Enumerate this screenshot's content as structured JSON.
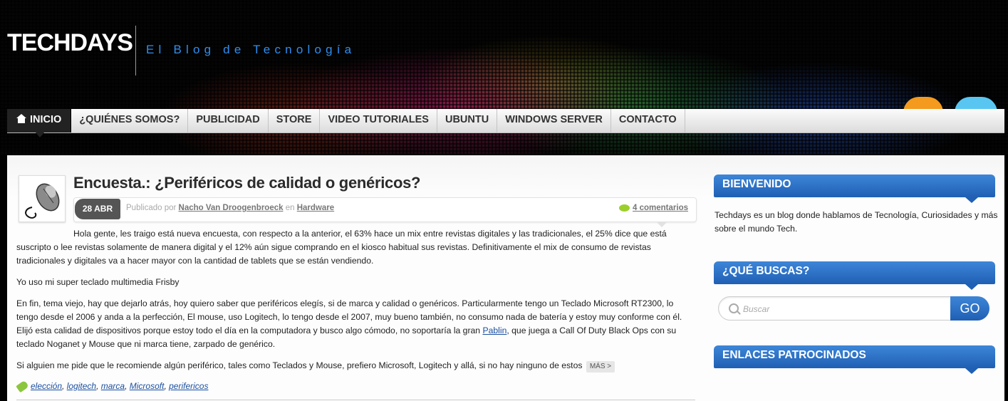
{
  "header": {
    "logo": "TECHDAYS",
    "tagline": "El Blog de Tecnología"
  },
  "social": {
    "rss_icon": "rss-icon",
    "twitter_icon": "twitter-icon"
  },
  "nav": {
    "items": [
      {
        "label": "INICIO",
        "icon": "home-icon",
        "active": true
      },
      {
        "label": "¿QUIÉNES SOMOS?"
      },
      {
        "label": "PUBLICIDAD"
      },
      {
        "label": "STORE"
      },
      {
        "label": "VIDEO TUTORIALES"
      },
      {
        "label": "UBUNTU"
      },
      {
        "label": "WINDOWS SERVER"
      },
      {
        "label": "CONTACTO"
      }
    ]
  },
  "post": {
    "title": "Encuesta.: ¿Periféricos de calidad o genéricos?",
    "date": "28 ABR",
    "published_by": "Publicado por",
    "author": "Nacho Van Droogenbroeck",
    "in_word": "en",
    "category": "Hardware",
    "comments": "4 comentarios",
    "paragraphs": {
      "p1": "Hola gente, les traigo está nueva encuesta, con respecto a la anterior, el 63% hace un mix entre revistas digitales y las tradicionales, el 25% dice que está suscripto o lee revistas solamente de manera digital y el 12% aún sigue comprando en el kiosco habitual sus revistas. Definitivamente el mix de consumo de revistas tradicionales y digitales va a hacer mayor con la cantidad de tablets que se están vendiendo.",
      "p2": "Yo uso mi super teclado multimedia Frisby",
      "p3_before": "En fin, tema viejo, hay que dejarlo atrás, hoy quiero saber que periféricos elegís, si de marca y calidad o genéricos. Particularmente tengo un Teclado Microsoft RT2300, lo tengo desde el 2006 y anda a la perfección, El mouse, uso Logitech, lo tengo desde el 2007, muy bueno también, no consumo nada de batería y estoy muy conforme con él. Elijó esta calidad de dispositivos porque estoy todo el día en la computadora y busco algo cómodo, no soportaría la gran ",
      "p3_link": "Pablin",
      "p3_after": ", que juega a Call Of Duty Black Ops con su teclado Noganet y Mouse que ni marca tiene, zarpado de genérico.",
      "p4": "Si alguien me pide que le recomiende algún periférico, tales como Teclados y Mouse, prefiero Microsoft, Logitech y allá, si no hay ninguno de estos"
    },
    "more_label": "MÁS >",
    "tags": [
      "elección",
      "logitech",
      "marca",
      "Microsoft",
      "perifericos"
    ]
  },
  "sidebar": {
    "welcome_title": "BIENVENIDO",
    "welcome_text": "Techdays es un blog donde hablamos de Tecnología, Curiosidades y más sobre el mundo Tech.",
    "search_title": "¿QUÉ BUSCAS?",
    "search_placeholder": "Buscar",
    "go_label": "GO",
    "sponsored_title": "ENLACES PATROCINADOS"
  },
  "colors": {
    "accent_blue": "#2f8ef0",
    "widget_blue": "#1f5fb4",
    "tag_green": "#8cc63f"
  }
}
